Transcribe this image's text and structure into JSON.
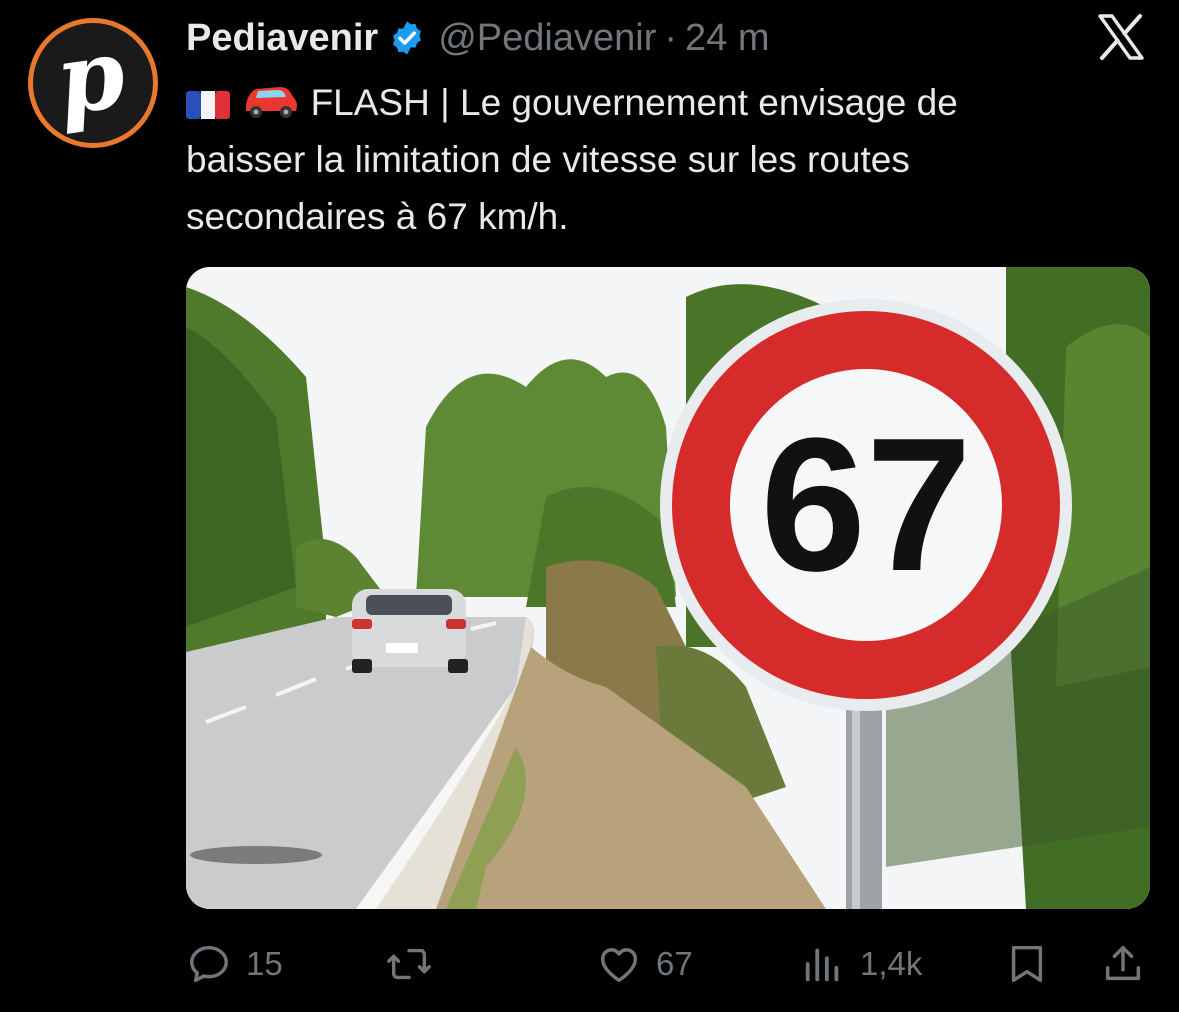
{
  "tweet": {
    "author_name": "Pediavenir",
    "handle": "@Pediavenir",
    "separator": "·",
    "time": "24 m",
    "avatar_letter": "p",
    "text_line1": "FLASH | Le gouvernement envisage de",
    "text_line2": "baisser la limitation de vitesse sur les routes",
    "text_line3": "secondaires à 67 km/h.",
    "emojis": [
      "flag-france-icon",
      "car-icon"
    ],
    "media": {
      "sign_number": "67"
    }
  },
  "actions": {
    "replies": "15",
    "reposts": "",
    "likes": "67",
    "views": "1,4k"
  },
  "colors": {
    "background": "#000000",
    "text": "#e7e9ea",
    "muted": "#71767b",
    "verified": "#1d9bf0",
    "avatar_ring": "#e8782c",
    "sign_red": "#d62b2b"
  }
}
